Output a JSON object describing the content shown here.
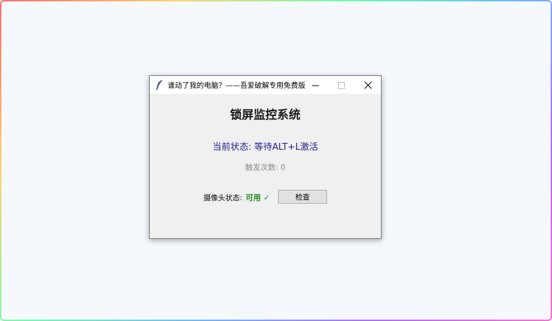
{
  "window": {
    "title": "谁动了我的电脑？——吾爱破解专用免费版",
    "icon": "feather-icon",
    "controls": {
      "minimize": "minimize-icon",
      "maximize": "maximize-icon",
      "close": "close-icon"
    }
  },
  "main": {
    "heading": "锁屏监控系统",
    "status": "当前状态: 等待ALT+L激活",
    "trigger_count": "触发次数: 0",
    "camera": {
      "label": "摄像头状态:",
      "value": "可用 ✓",
      "check_button": "检查"
    }
  },
  "colors": {
    "status_text": "#1f1f8a",
    "camera_ok": "#1e8a1e",
    "trigger_text": "#8a8a8a",
    "window_bg": "#f0f0f0"
  }
}
